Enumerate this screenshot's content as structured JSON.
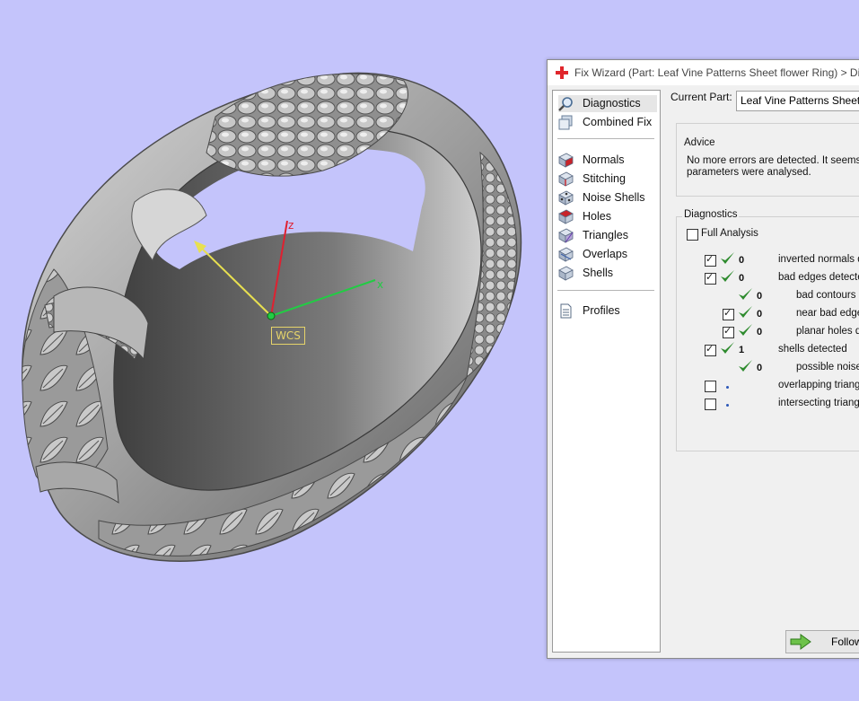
{
  "viewport": {
    "wcs_label": "WCS",
    "axes": {
      "z": "z",
      "x": "x"
    }
  },
  "dialog": {
    "title": "Fix Wizard (Part: Leaf Vine Patterns Sheet flower Ring) > Diag",
    "nav": {
      "group1": [
        {
          "label": "Diagnostics",
          "icon": "magnifier-icon",
          "selected": true
        },
        {
          "label": "Combined Fix",
          "icon": "cube-stack-icon"
        }
      ],
      "group2": [
        {
          "label": "Normals",
          "icon": "normals-cube-icon"
        },
        {
          "label": "Stitching",
          "icon": "stitching-cube-icon"
        },
        {
          "label": "Noise Shells",
          "icon": "noise-shells-icon"
        },
        {
          "label": "Holes",
          "icon": "holes-cube-icon"
        },
        {
          "label": "Triangles",
          "icon": "triangles-cube-icon"
        },
        {
          "label": "Overlaps",
          "icon": "overlaps-cube-icon"
        },
        {
          "label": "Shells",
          "icon": "shells-cube-icon"
        }
      ],
      "group3": [
        {
          "label": "Profiles",
          "icon": "document-icon"
        }
      ]
    },
    "current_part_label": "Current Part:",
    "current_part_value": "Leaf Vine Patterns Sheet flow",
    "advice": {
      "title": "Advice",
      "line1": "No more errors are detected. It seems t",
      "line2": "parameters were analysed."
    },
    "diagnostics": {
      "title": "Diagnostics",
      "full_analysis_label": "Full Analysis",
      "full_analysis_checked": false,
      "rows": [
        {
          "label": "inverted normals d",
          "count": "0",
          "checked": true,
          "status": "ok",
          "level": 0
        },
        {
          "label": "bad edges detecte",
          "count": "0",
          "checked": true,
          "status": "ok",
          "level": 0
        },
        {
          "label": "bad contours c",
          "count": "0",
          "checked": null,
          "status": "ok",
          "level": 1
        },
        {
          "label": "near bad edge",
          "count": "0",
          "checked": true,
          "status": "ok",
          "level": 1
        },
        {
          "label": "planar holes de",
          "count": "0",
          "checked": true,
          "status": "ok",
          "level": 1
        },
        {
          "label": "shells detected",
          "count": "1",
          "checked": true,
          "status": "ok",
          "level": 0
        },
        {
          "label": "possible noise",
          "count": "0",
          "checked": null,
          "status": "ok",
          "level": 1
        },
        {
          "label": "overlapping triangl",
          "count": "",
          "checked": false,
          "status": "pending",
          "level": 0
        },
        {
          "label": "intersecting triangl",
          "count": "",
          "checked": false,
          "status": "pending",
          "level": 0
        }
      ]
    },
    "follow_button": "Follow"
  },
  "colors": {
    "background": "#c4c4fb",
    "check_green": "#2e8b2e",
    "axis_x": "#22cc44",
    "axis_z": "#e02030",
    "axis_other": "#e8e050"
  }
}
